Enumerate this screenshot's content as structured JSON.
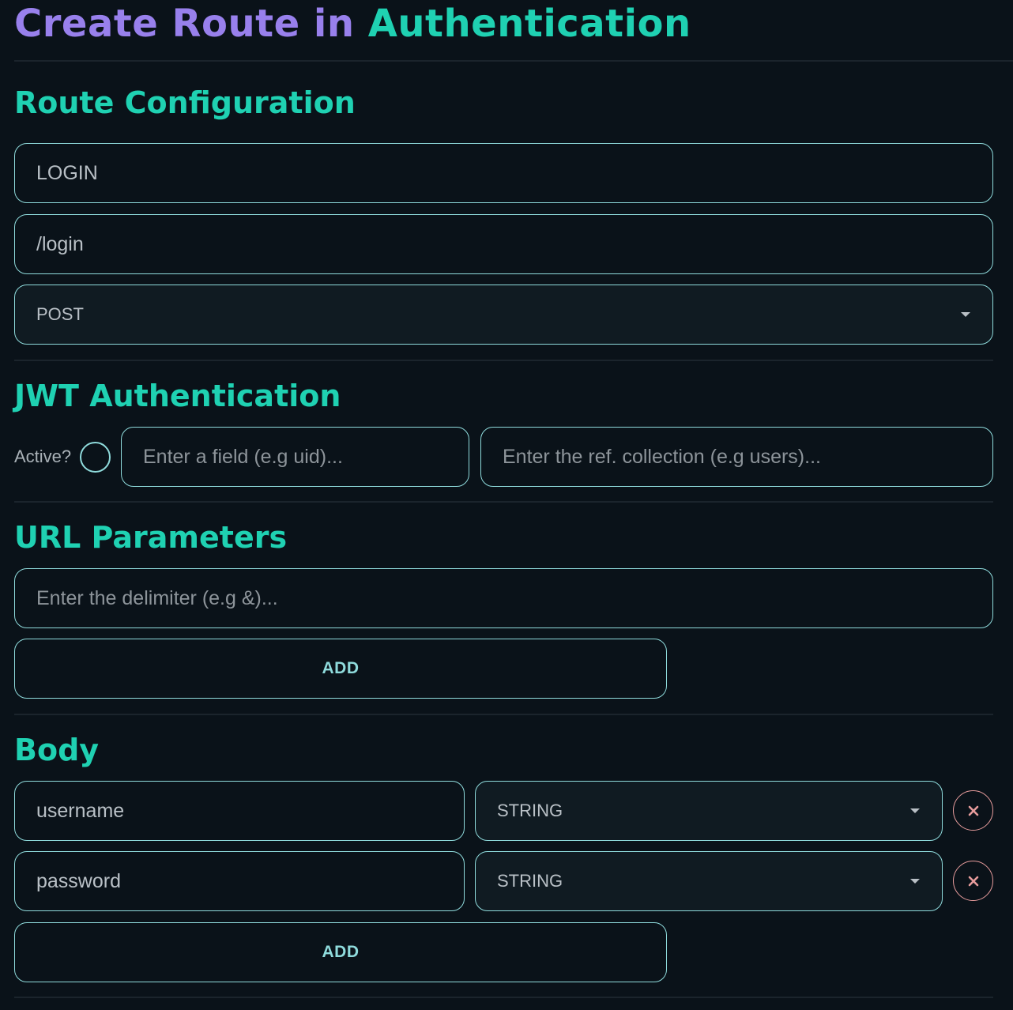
{
  "header": {
    "title_part1": "Create Route in ",
    "title_part2": "Authentication"
  },
  "route_config": {
    "title": "Route Configuration",
    "name_value": "LOGIN",
    "path_value": "/login",
    "method_selected": "POST"
  },
  "jwt": {
    "title": "JWT Authentication",
    "active_label": "Active?",
    "field_placeholder": "Enter a field (e.g uid)...",
    "collection_placeholder": "Enter the ref. collection (e.g users)..."
  },
  "url_params": {
    "title": "URL Parameters",
    "delimiter_placeholder": "Enter the delimiter (e.g &)...",
    "add_label": "ADD"
  },
  "body": {
    "title": "Body",
    "rows": [
      {
        "name": "username",
        "type": "STRING"
      },
      {
        "name": "password",
        "type": "STRING"
      }
    ],
    "add_label": "ADD"
  },
  "colors": {
    "accent_purple": "#9880ec",
    "accent_teal": "#1fd1b2",
    "border": "#8fdbdc",
    "remove": "#e79c9c"
  }
}
